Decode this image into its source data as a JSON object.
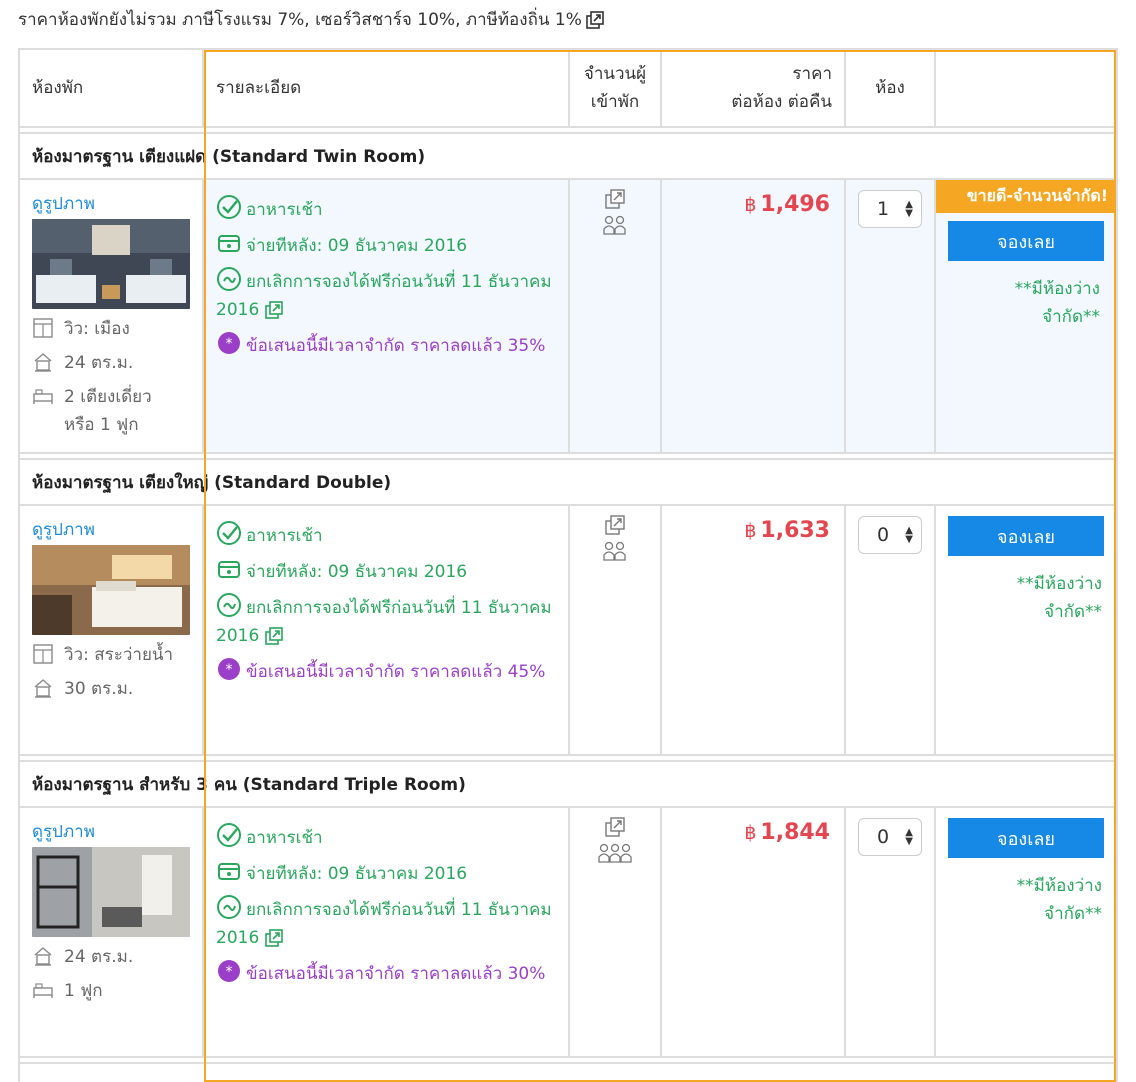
{
  "tax_note": "ราคาห้องพักยังไม่รวม ภาษีโรงแรม 7%, เซอร์วิสชาร์จ 10%, ภาษีท้องถิ่น 1%",
  "headers": {
    "room": "ห้องพัก",
    "details": "รายละเอียด",
    "guests": "จำนวนผู้เข้าพัก",
    "price_line1": "ราคา",
    "price_line2": "ต่อห้อง ต่อคืน",
    "rooms": "ห้อง"
  },
  "colors": {
    "price": "#e4454f",
    "green": "#29a75d",
    "purple": "#9b3fc9",
    "button": "#1589e5",
    "badge": "#f5a623",
    "link": "#1e8bd8"
  },
  "rooms": [
    {
      "name": "ห้องมาตรฐาน เตียงแฝด (Standard Twin Room)",
      "photo_link": "ดูรูปภาพ",
      "view": "วิว: เมือง",
      "size": "24 ตร.ม.",
      "bed": "2 เตียงเดี่ยว หรือ 1 ฟูก",
      "breakfast": "อาหารเช้า",
      "pay_later": "จ่ายทีหลัง: 09 ธันวาคม 2016",
      "cancel": "ยกเลิกการจองได้ฟรีก่อนวันที่ 11 ธันวาคม 2016",
      "deal": "ข้อเสนอนี้มีเวลาจำกัด ราคาลดแล้ว 35%",
      "guest_count": 2,
      "currency": "฿",
      "price": "1,496",
      "qty": "1",
      "badge": "ขายดี-จำนวนจำกัด!",
      "book": "จองเลย",
      "availability": "**มีห้องว่างจำกัด**"
    },
    {
      "name": "ห้องมาตรฐาน เตียงใหญ่ (Standard Double)",
      "photo_link": "ดูรูปภาพ",
      "view": "วิว: สระว่ายน้ำ",
      "size": "30 ตร.ม.",
      "breakfast": "อาหารเช้า",
      "pay_later": "จ่ายทีหลัง: 09 ธันวาคม 2016",
      "cancel": "ยกเลิกการจองได้ฟรีก่อนวันที่ 11 ธันวาคม 2016",
      "deal": "ข้อเสนอนี้มีเวลาจำกัด ราคาลดแล้ว 45%",
      "guest_count": 2,
      "currency": "฿",
      "price": "1,633",
      "qty": "0",
      "book": "จองเลย",
      "availability": "**มีห้องว่างจำกัด**"
    },
    {
      "name": "ห้องมาตรฐาน สำหรับ 3 คน (Standard Triple Room)",
      "photo_link": "ดูรูปภาพ",
      "size": "24 ตร.ม.",
      "bed": "1 ฟูก",
      "breakfast": "อาหารเช้า",
      "pay_later": "จ่ายทีหลัง: 09 ธันวาคม 2016",
      "cancel": "ยกเลิกการจองได้ฟรีก่อนวันที่ 11 ธันวาคม 2016",
      "deal": "ข้อเสนอนี้มีเวลาจำกัด ราคาลดแล้ว 30%",
      "guest_count": 3,
      "currency": "฿",
      "price": "1,844",
      "qty": "0",
      "book": "จองเลย",
      "availability": "**มีห้องว่างจำกัด**"
    }
  ]
}
